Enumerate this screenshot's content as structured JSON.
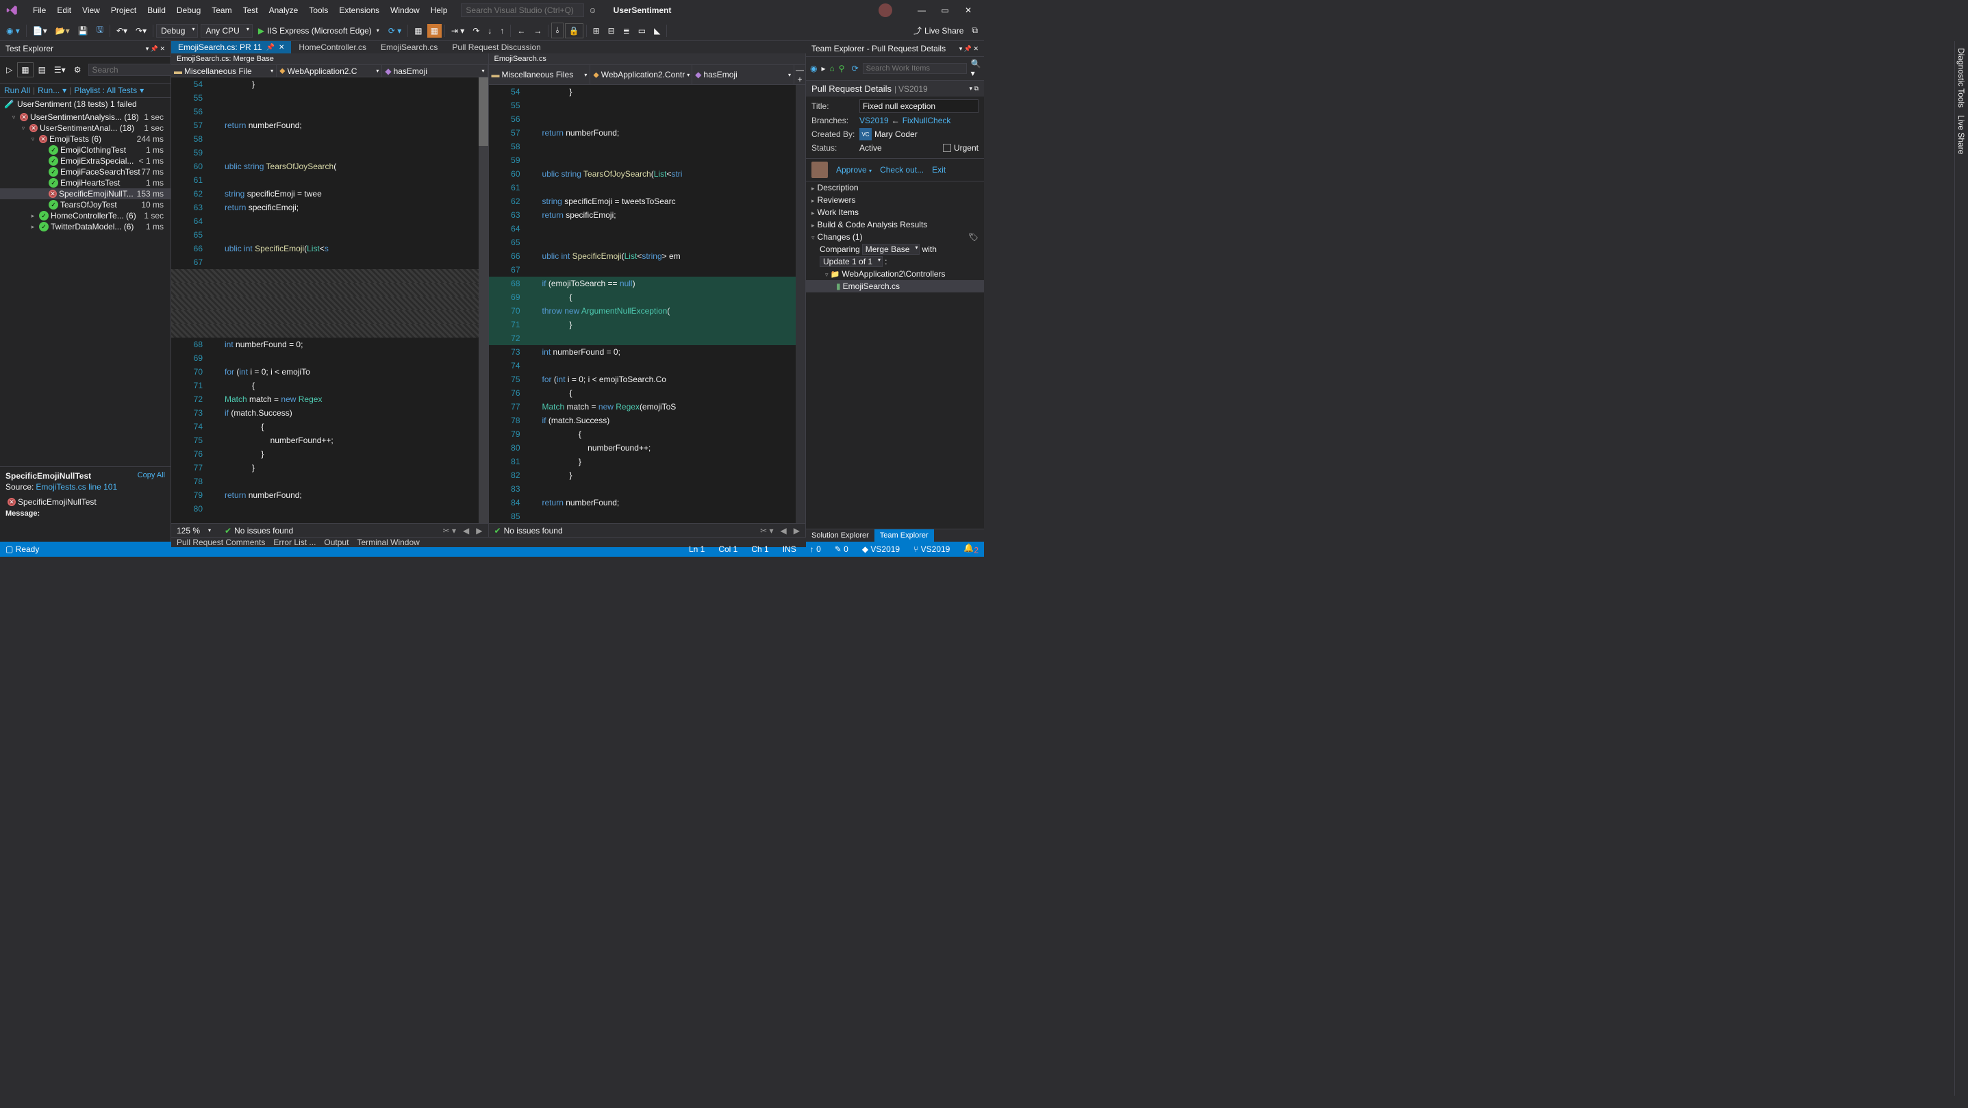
{
  "menu": [
    "File",
    "Edit",
    "View",
    "Project",
    "Build",
    "Debug",
    "Team",
    "Test",
    "Analyze",
    "Tools",
    "Extensions",
    "Window",
    "Help"
  ],
  "title_search_placeholder": "Search Visual Studio (Ctrl+Q)",
  "solution_name": "UserSentiment",
  "toolbar": {
    "config": "Debug",
    "platform": "Any CPU",
    "run_target": "IIS Express (Microsoft Edge)",
    "live_share": "Live Share"
  },
  "tabs": [
    {
      "label": "EmojiSearch.cs: PR 11",
      "active": true,
      "closable": true,
      "pinned": true
    },
    {
      "label": "HomeController.cs",
      "active": false
    },
    {
      "label": "EmojiSearch.cs",
      "active": false
    },
    {
      "label": "Pull Request Discussion",
      "active": false
    }
  ],
  "left_pane_header": "EmojiSearch.cs: Merge Base",
  "right_pane_header": "EmojiSearch.cs",
  "nav_left": {
    "scope": "Miscellaneous File",
    "class": "WebApplication2.C",
    "member": "hasEmoji"
  },
  "nav_right": {
    "scope": "Miscellaneous Files",
    "class": "WebApplication2.Contr",
    "member": "hasEmoji"
  },
  "left_code": [
    {
      "n": 54,
      "t": "            }"
    },
    {
      "n": 55,
      "t": ""
    },
    {
      "n": 56,
      "t": ""
    },
    {
      "n": 57,
      "t": "            return numberFound;",
      "tok": [
        [
          "k",
          "return"
        ],
        [
          " "
        ],
        [
          "",
          "numberFound;"
        ]
      ]
    },
    {
      "n": 58,
      "t": ""
    },
    {
      "n": 59,
      "t": ""
    },
    {
      "n": 60,
      "t": "       ublic string TearsOfJoySearch(",
      "tok": [
        [
          "k",
          "ublic"
        ],
        [
          " "
        ],
        [
          "k",
          "string"
        ],
        [
          " "
        ],
        [
          "c",
          "TearsOfJoySearch"
        ],
        [
          "",
          "("
        ]
      ]
    },
    {
      "n": 61,
      "t": ""
    },
    {
      "n": 62,
      "t": "            string specificEmoji = twee",
      "tok": [
        [
          "k",
          "string"
        ],
        [
          " "
        ],
        [
          "",
          "specificEmoji = twee"
        ]
      ]
    },
    {
      "n": 63,
      "t": "            return specificEmoji;",
      "tok": [
        [
          "k",
          "return"
        ],
        [
          " "
        ],
        [
          "",
          "specificEmoji;"
        ]
      ]
    },
    {
      "n": 64,
      "t": ""
    },
    {
      "n": 65,
      "t": ""
    },
    {
      "n": 66,
      "t": "       ublic int SpecificEmoji(List<s",
      "tok": [
        [
          "k",
          "ublic"
        ],
        [
          " "
        ],
        [
          "k",
          "int"
        ],
        [
          " "
        ],
        [
          "c",
          "SpecificEmoji"
        ],
        [
          "",
          "("
        ],
        [
          "t",
          "List"
        ],
        [
          "",
          "<"
        ],
        [
          "k",
          "s"
        ]
      ]
    },
    {
      "n": 67,
      "t": ""
    },
    {
      "n": "",
      "t": "",
      "del": true
    },
    {
      "n": "",
      "t": "",
      "del": true
    },
    {
      "n": "",
      "t": "",
      "del": true
    },
    {
      "n": "",
      "t": "",
      "del": true
    },
    {
      "n": "",
      "t": "",
      "del": true
    },
    {
      "n": 68,
      "t": "            int numberFound = 0;",
      "tok": [
        [
          "k",
          "int"
        ],
        [
          " "
        ],
        [
          "",
          "numberFound = 0;"
        ]
      ]
    },
    {
      "n": 69,
      "t": ""
    },
    {
      "n": 70,
      "t": "            for (int i = 0; i < emojiTo",
      "tok": [
        [
          "k",
          "for"
        ],
        [
          " ("
        ],
        [
          "k",
          "int"
        ],
        [
          " i = 0; i < emojiTo"
        ]
      ]
    },
    {
      "n": 71,
      "t": "            {"
    },
    {
      "n": 72,
      "t": "                Match match = new Regex",
      "tok": [
        [
          "t",
          "Match"
        ],
        [
          " match = "
        ],
        [
          "k",
          "new"
        ],
        [
          " "
        ],
        [
          "t",
          "Regex"
        ]
      ]
    },
    {
      "n": 73,
      "t": "                if (match.Success)",
      "tok": [
        [
          "k",
          "if"
        ],
        [
          " (match.Success)"
        ]
      ]
    },
    {
      "n": 74,
      "t": "                {"
    },
    {
      "n": 75,
      "t": "                    numberFound++;"
    },
    {
      "n": 76,
      "t": "                }"
    },
    {
      "n": 77,
      "t": "            }"
    },
    {
      "n": 78,
      "t": ""
    },
    {
      "n": 79,
      "t": "            return numberFound;",
      "tok": [
        [
          "k",
          "return"
        ],
        [
          " numberFound;"
        ]
      ]
    },
    {
      "n": 80,
      "t": ""
    }
  ],
  "right_code": [
    {
      "n": 54,
      "t": "            }"
    },
    {
      "n": 55,
      "t": ""
    },
    {
      "n": 56,
      "t": ""
    },
    {
      "n": 57,
      "t": "            return numberFound;",
      "tok": [
        [
          "k",
          "return"
        ],
        [
          " numberFound;"
        ]
      ]
    },
    {
      "n": 58,
      "t": ""
    },
    {
      "n": 59,
      "t": ""
    },
    {
      "n": 60,
      "t": "       ublic string TearsOfJoySearch(List<stri",
      "tok": [
        [
          "k",
          "ublic"
        ],
        [
          " "
        ],
        [
          "k",
          "string"
        ],
        [
          " "
        ],
        [
          "c",
          "TearsOfJoySearch"
        ],
        [
          "("
        ],
        [
          "t",
          "List"
        ],
        [
          "<"
        ],
        [
          "k",
          "stri"
        ]
      ]
    },
    {
      "n": 61,
      "t": ""
    },
    {
      "n": 62,
      "t": "            string specificEmoji = tweetsToSearc",
      "tok": [
        [
          "k",
          "string"
        ],
        [
          " specificEmoji = tweetsToSearc"
        ]
      ]
    },
    {
      "n": 63,
      "t": "            return specificEmoji;",
      "tok": [
        [
          "k",
          "return"
        ],
        [
          " specificEmoji;"
        ]
      ]
    },
    {
      "n": 64,
      "t": ""
    },
    {
      "n": 65,
      "t": ""
    },
    {
      "n": 66,
      "t": "       ublic int SpecificEmoji(List<string> em",
      "tok": [
        [
          "k",
          "ublic"
        ],
        [
          " "
        ],
        [
          "k",
          "int"
        ],
        [
          " "
        ],
        [
          "c",
          "SpecificEmoji"
        ],
        [
          "("
        ],
        [
          "t",
          "List"
        ],
        [
          "<"
        ],
        [
          "k",
          "string"
        ],
        [
          "> em"
        ]
      ]
    },
    {
      "n": 67,
      "t": ""
    },
    {
      "n": 68,
      "t": "            if (emojiToSearch == null)",
      "add": true,
      "tok": [
        [
          "k",
          "if"
        ],
        [
          " (emojiToSearch == "
        ],
        [
          "k",
          "null"
        ],
        [
          ")"
        ]
      ]
    },
    {
      "n": 69,
      "t": "            {",
      "add": true
    },
    {
      "n": 70,
      "t": "                throw new ArgumentNullException(",
      "add": true,
      "tok": [
        [
          "k",
          "throw"
        ],
        [
          " "
        ],
        [
          "k",
          "new"
        ],
        [
          " "
        ],
        [
          "t",
          "ArgumentNullException"
        ],
        [
          "("
        ]
      ]
    },
    {
      "n": 71,
      "t": "            }",
      "add": true
    },
    {
      "n": 72,
      "t": "",
      "add": true
    },
    {
      "n": 73,
      "t": "            int numberFound = 0;",
      "tok": [
        [
          "k",
          "int"
        ],
        [
          " numberFound = 0;"
        ]
      ]
    },
    {
      "n": 74,
      "t": ""
    },
    {
      "n": 75,
      "t": "            for (int i = 0; i < emojiToSearch.Co",
      "tok": [
        [
          "k",
          "for"
        ],
        [
          " ("
        ],
        [
          "k",
          "int"
        ],
        [
          " i = 0; i < emojiToSearch.Co"
        ]
      ]
    },
    {
      "n": 76,
      "t": "            {"
    },
    {
      "n": 77,
      "t": "                Match match = new Regex(emojiToS",
      "tok": [
        [
          "t",
          "Match"
        ],
        [
          " match = "
        ],
        [
          "k",
          "new"
        ],
        [
          " "
        ],
        [
          "t",
          "Regex"
        ],
        [
          "(emojiToS"
        ]
      ]
    },
    {
      "n": 78,
      "t": "                if (match.Success)",
      "tok": [
        [
          "k",
          "if"
        ],
        [
          " (match.Success)"
        ]
      ]
    },
    {
      "n": 79,
      "t": "                {"
    },
    {
      "n": 80,
      "t": "                    numberFound++;"
    },
    {
      "n": 81,
      "t": "                }"
    },
    {
      "n": 82,
      "t": "            }"
    },
    {
      "n": 83,
      "t": ""
    },
    {
      "n": 84,
      "t": "            return numberFound;",
      "tok": [
        [
          "k",
          "return"
        ],
        [
          " numberFound;"
        ]
      ]
    },
    {
      "n": 85,
      "t": ""
    }
  ],
  "editor_footer": {
    "zoom": "125 %",
    "issues": "No issues found"
  },
  "test_explorer": {
    "title": "Test Explorer",
    "search_placeholder": "Search",
    "run_all": "Run All",
    "run": "Run...",
    "playlist": "Playlist : All Tests",
    "summary": "UserSentiment (18 tests) 1 failed",
    "tree": [
      {
        "indent": 1,
        "exp": "▿",
        "status": "fail",
        "label": "UserSentimentAnalysis... (18)",
        "time": "1 sec"
      },
      {
        "indent": 2,
        "exp": "▿",
        "status": "fail",
        "label": "UserSentimentAnal... (18)",
        "time": "1 sec"
      },
      {
        "indent": 3,
        "exp": "▿",
        "status": "fail",
        "label": "EmojiTests (6)",
        "time": "244 ms"
      },
      {
        "indent": 4,
        "status": "pass",
        "label": "EmojiClothingTest",
        "time": "1 ms"
      },
      {
        "indent": 4,
        "status": "pass",
        "label": "EmojiExtraSpecial...",
        "time": "< 1 ms"
      },
      {
        "indent": 4,
        "status": "pass",
        "label": "EmojiFaceSearchTest",
        "time": "77 ms"
      },
      {
        "indent": 4,
        "status": "pass",
        "label": "EmojiHeartsTest",
        "time": "1 ms"
      },
      {
        "indent": 4,
        "status": "fail",
        "label": "SpecificEmojiNullT...",
        "time": "153 ms",
        "selected": true
      },
      {
        "indent": 4,
        "status": "pass",
        "label": "TearsOfJoyTest",
        "time": "10 ms"
      },
      {
        "indent": 3,
        "exp": "▸",
        "status": "pass",
        "label": "HomeControllerTe... (6)",
        "time": "1 sec"
      },
      {
        "indent": 3,
        "exp": "▸",
        "status": "pass",
        "label": "TwitterDataModel... (6)",
        "time": "1 ms"
      }
    ],
    "detail": {
      "name": "SpecificEmojiNullTest",
      "copy_all": "Copy All",
      "source_label": "Source:",
      "source_link": "EmojiTests.cs line 101",
      "status_label": "SpecificEmojiNullTest",
      "message_label": "Message:"
    }
  },
  "team_explorer": {
    "title": "Team Explorer - Pull Request Details",
    "search_placeholder": "Search Work Items",
    "header": "Pull Request Details",
    "header_sub": "VS2019",
    "title_label": "Title:",
    "title_value": "Fixed null exception",
    "branches_label": "Branches:",
    "branch_target": "VS2019",
    "branch_arrow": "←",
    "branch_source": "FixNullCheck",
    "created_label": "Created By:",
    "created_badge": "VC",
    "created_name": "Mary Coder",
    "status_label": "Status:",
    "status_value": "Active",
    "urgent_label": "Urgent",
    "approve": "Approve",
    "checkout": "Check out...",
    "exit": "Exit",
    "sections": [
      "Description",
      "Reviewers",
      "Work Items",
      "Build & Code Analysis Results"
    ],
    "changes_label": "Changes (1)",
    "comparing": "Comparing",
    "compare_mode": "Merge Base",
    "with": "with",
    "update": "Update 1 of 1",
    "colon": ":",
    "folder": "WebApplication2\\Controllers",
    "file": "EmojiSearch.cs",
    "bottom_tabs": [
      "Solution Explorer",
      "Team Explorer"
    ]
  },
  "bottom_tabs": [
    "Pull Request Comments",
    "Error List ...",
    "Output",
    "Terminal Window"
  ],
  "status_bar": {
    "ready": "Ready",
    "ln": "Ln 1",
    "col": "Col 1",
    "ch": "Ch 1",
    "ins": "INS",
    "up": "0",
    "pencil": "0",
    "repo": "VS2019",
    "branch": "VS2019",
    "bell": "2"
  },
  "right_rail": [
    "Diagnostic Tools",
    "Live Share"
  ]
}
